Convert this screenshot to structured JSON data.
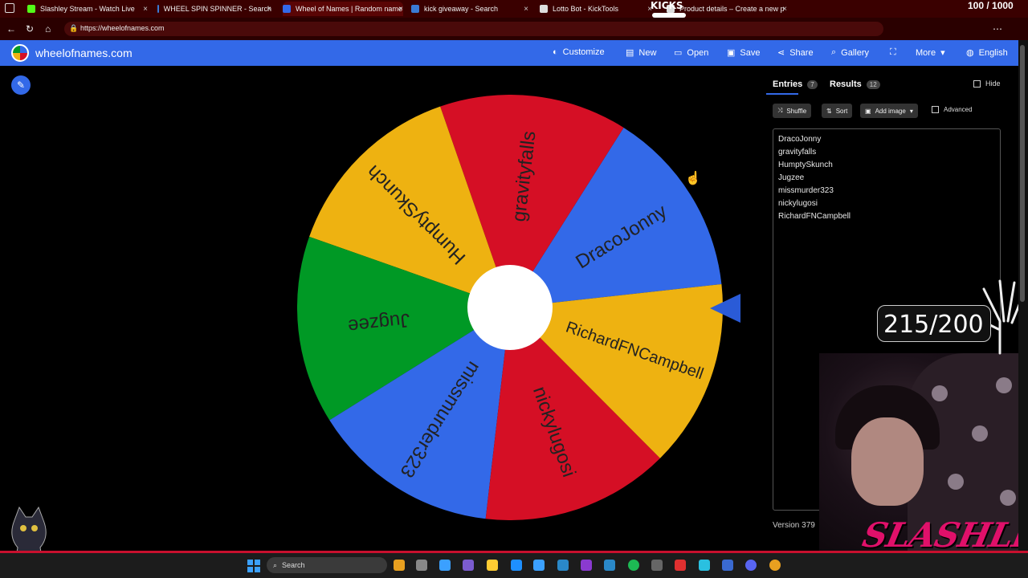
{
  "browser": {
    "tabs": [
      {
        "title": "Slashley Stream - Watch Live",
        "icon_color": "#53fc18"
      },
      {
        "title": "WHEEL SPIN SPINNER - Search",
        "icon_color": "#3a7bd5"
      },
      {
        "title": "Wheel of Names | Random name",
        "icon_color": "#3369e8"
      },
      {
        "title": "kick giveaway - Search",
        "icon_color": "#3a7bd5"
      },
      {
        "title": "Lotto Bot - KickTools",
        "icon_color": "#dddddd"
      },
      {
        "title": "Product details – Create a new p",
        "icon_color": "#dddddd"
      }
    ],
    "url": "https://wheelofnames.com",
    "overlay_logo": "KICKS",
    "overlay_counter": "100 / 1000"
  },
  "header": {
    "brand": "wheelofnames.com",
    "buttons": [
      {
        "label": "Customize",
        "icon": "palette-icon"
      },
      {
        "label": "New",
        "icon": "file-icon"
      },
      {
        "label": "Open",
        "icon": "folder-icon"
      },
      {
        "label": "Save",
        "icon": "save-icon"
      },
      {
        "label": "Share",
        "icon": "share-icon"
      },
      {
        "label": "Gallery",
        "icon": "search-icon"
      },
      {
        "label": "",
        "icon": "fullscreen-icon"
      },
      {
        "label": "More",
        "icon": "chevron-down-icon"
      },
      {
        "label": "English",
        "icon": "globe-icon"
      }
    ]
  },
  "wheel": {
    "segments": [
      {
        "name": "DracoJonny",
        "color": "#3369e8"
      },
      {
        "name": "gravityfalls",
        "color": "#d50f25"
      },
      {
        "name": "HumptySkunch",
        "color": "#eeb211"
      },
      {
        "name": "Jugzee",
        "color": "#009925"
      },
      {
        "name": "missmurder323",
        "color": "#3369e8"
      },
      {
        "name": "nickylugosi",
        "color": "#d50f25"
      },
      {
        "name": "RichardFNCampbell",
        "color": "#eeb211"
      }
    ]
  },
  "panel": {
    "tabs": [
      {
        "label": "Entries",
        "count": "7"
      },
      {
        "label": "Results",
        "count": "12"
      }
    ],
    "hide_label": "Hide",
    "toolbar": {
      "shuffle": "Shuffle",
      "sort": "Sort",
      "add_image": "Add image",
      "advanced": "Advanced"
    },
    "entries": [
      "DracoJonny",
      "gravityfalls",
      "HumptySkunch",
      "Jugzee",
      "missmurder323",
      "nickylugosi",
      "RichardFNCampbell"
    ],
    "version": "Version 379"
  },
  "overlay": {
    "counter": "215/200",
    "streamer_name": "SLASHLEY"
  },
  "taskbar": {
    "search_placeholder": "Search"
  }
}
